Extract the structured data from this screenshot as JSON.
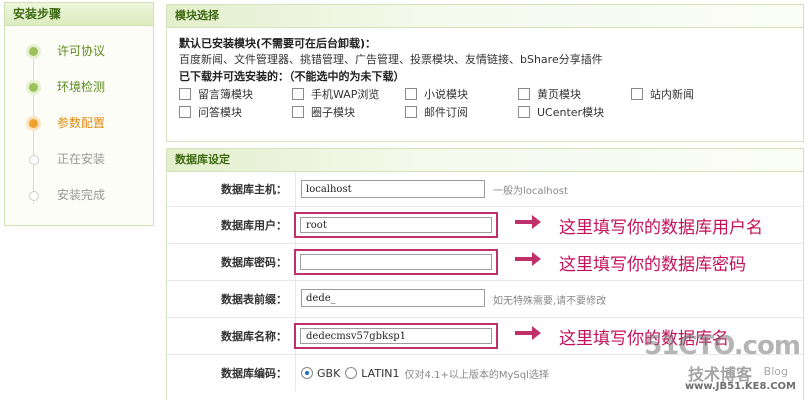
{
  "sidebar": {
    "title": "安装步骤",
    "steps": [
      {
        "label": "许可协议",
        "state": "done"
      },
      {
        "label": "环境检测",
        "state": "done"
      },
      {
        "label": "参数配置",
        "state": "current"
      },
      {
        "label": "正在安装",
        "state": "todo"
      },
      {
        "label": "安装完成",
        "state": "todo"
      }
    ]
  },
  "modules": {
    "title": "模块选择",
    "installed_label": "默认已安装模块(不需要可在后台卸载)：",
    "installed_list": "百度新闻、文件管理器、挑错管理、广告管理、投票模块、友情链接、bShare分享插件",
    "optional_label": "已下载并可选安装的：（不能选中的为未下载）",
    "options": [
      {
        "label": "留言簿模块",
        "checked": false
      },
      {
        "label": "手机WAP浏览",
        "checked": false
      },
      {
        "label": "小说模块",
        "checked": false
      },
      {
        "label": "黄页模块",
        "checked": false
      },
      {
        "label": "站内新闻",
        "checked": false
      },
      {
        "label": "问答模块",
        "checked": false
      },
      {
        "label": "圈子模块",
        "checked": false
      },
      {
        "label": "邮件订阅",
        "checked": false
      },
      {
        "label": "UCenter模块",
        "checked": false
      }
    ]
  },
  "database": {
    "title": "数据库设定",
    "host": {
      "label": "数据库主机：",
      "value": "localhost",
      "hint": "一般为localhost"
    },
    "user": {
      "label": "数据库用户：",
      "value": "root",
      "note": "这里填写你的数据库用户名"
    },
    "password": {
      "label": "数据库密码：",
      "value": "",
      "note": "这里填写你的数据库密码"
    },
    "prefix": {
      "label": "数据表前缀：",
      "value": "dede_",
      "hint": "如无特殊需要,请不要修改"
    },
    "name": {
      "label": "数据库名称：",
      "value": "dedecmsv57gbksp1",
      "note": "这里填写你的数据库名"
    },
    "encoding": {
      "label": "数据库编码：",
      "options": [
        {
          "label": "GBK",
          "selected": true
        },
        {
          "label": "LATIN1",
          "selected": false
        }
      ],
      "hint": "仅对4.1+以上版本的MySql选择"
    }
  },
  "watermark": {
    "top": "51CTO.com",
    "sub": "技术博客",
    "blog": "Blog",
    "site": "www.JB51.KE8.COM"
  },
  "colors": {
    "accent_green": "#3e6b12",
    "highlight_magenta": "#c0306a",
    "current_step_orange": "#e08a12"
  }
}
